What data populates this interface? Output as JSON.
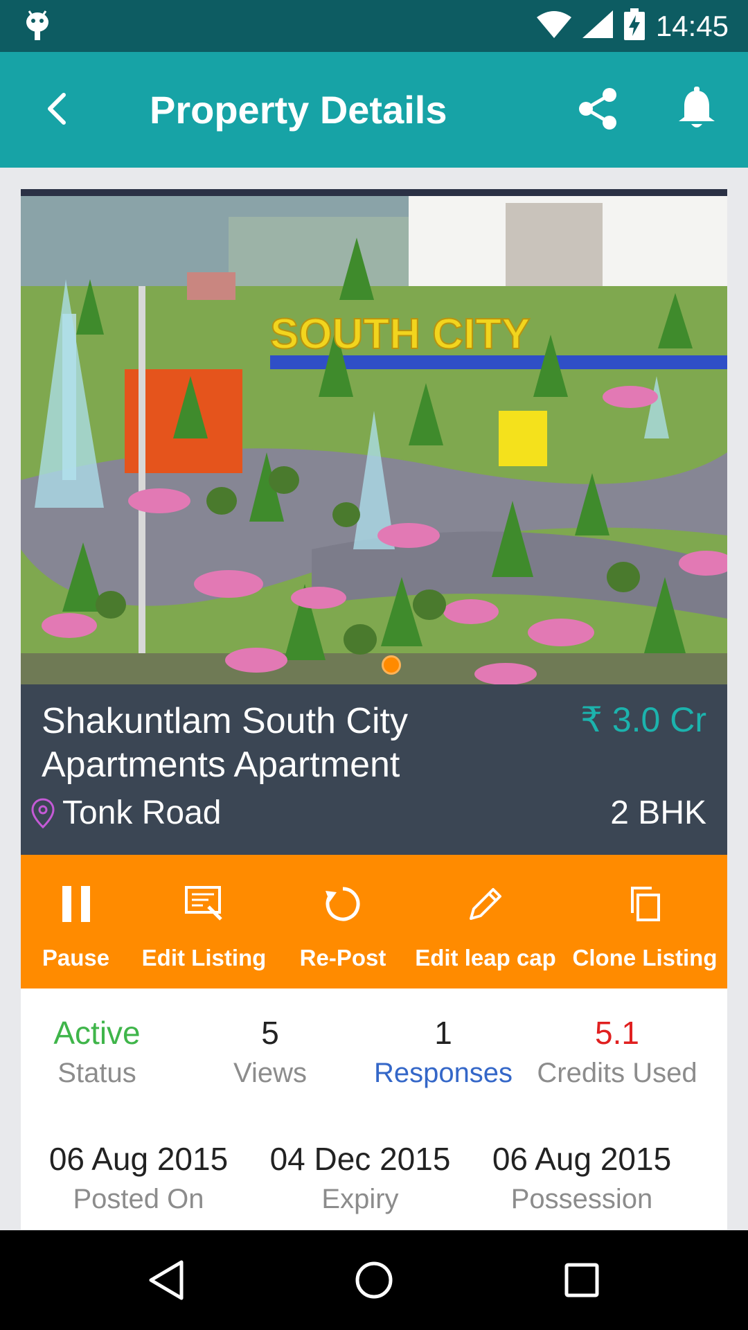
{
  "status_bar": {
    "time": "14:45",
    "icons": [
      "android-debug-icon",
      "wifi-icon",
      "signal-icon",
      "battery-charging-icon"
    ]
  },
  "app_bar": {
    "title": "Property Details",
    "icons": [
      "back-arrow-icon",
      "share-icon",
      "bell-icon"
    ]
  },
  "property": {
    "image_text": "SOUTH CITY",
    "name": "Shakuntlam South City Apartments Apartment",
    "price": "₹ 3.0 Cr",
    "location": "Tonk Road",
    "bhk": "2 BHK"
  },
  "actions": [
    {
      "label": "Pause",
      "icon": "pause-icon"
    },
    {
      "label": "Edit Listing",
      "icon": "edit-listing-icon"
    },
    {
      "label": "Re-Post",
      "icon": "refresh-icon"
    },
    {
      "label": "Edit leap cap",
      "icon": "pencil-icon"
    },
    {
      "label": "Clone Listing",
      "icon": "copy-icon"
    }
  ],
  "stats": [
    {
      "value": "Active",
      "label": "Status"
    },
    {
      "value": "5",
      "label": "Views"
    },
    {
      "value": "1",
      "label": "Responses"
    },
    {
      "value": "5.1",
      "label": "Credits Used"
    }
  ],
  "dates": [
    {
      "value": "06 Aug 2015",
      "label": "Posted On"
    },
    {
      "value": "04 Dec 2015",
      "label": "Expiry"
    },
    {
      "value": "06 Aug 2015",
      "label": "Possession"
    }
  ],
  "colors": {
    "status_bar": "#0d5c62",
    "app_bar": "#17a3a6",
    "info_panel": "#3b4654",
    "price": "#1cb3ad",
    "action_bar": "#ff8b00",
    "active": "#3fb54a",
    "responses": "#3467c8",
    "credits": "#e02020",
    "location_icon": "#c45ad6"
  },
  "nav_bar": {
    "icons": [
      "back-triangle-icon",
      "home-circle-icon",
      "recents-square-icon"
    ]
  }
}
